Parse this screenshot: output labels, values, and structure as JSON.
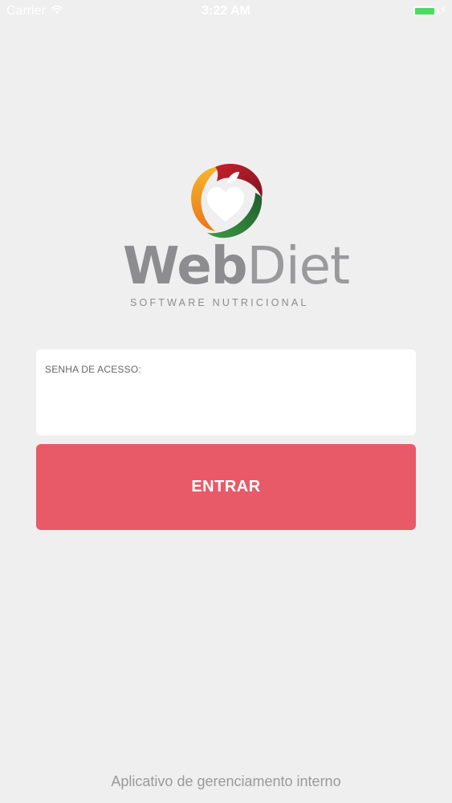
{
  "status_bar": {
    "carrier": "Carrier",
    "time": "3:22 AM",
    "wifi_icon": "wifi-icon",
    "battery_icon": "battery-icon",
    "battery_color": "#4cd964",
    "battery_level": 1.0
  },
  "brand": {
    "logo_icon": "apple-heart-logo-icon",
    "name_part1": "Web",
    "name_part2": "Diet",
    "tagline": "SOFTWARE NUTRICIONAL",
    "colors": {
      "orange": "#f29a1f",
      "red": "#b51e28",
      "green": "#2f8a3a"
    }
  },
  "login": {
    "password_label": "SENHA DE ACESSO:",
    "password_value": "",
    "enter_label": "ENTRAR",
    "button_color": "#e85a68"
  },
  "footer": {
    "text": "Aplicativo de gerenciamento interno"
  }
}
